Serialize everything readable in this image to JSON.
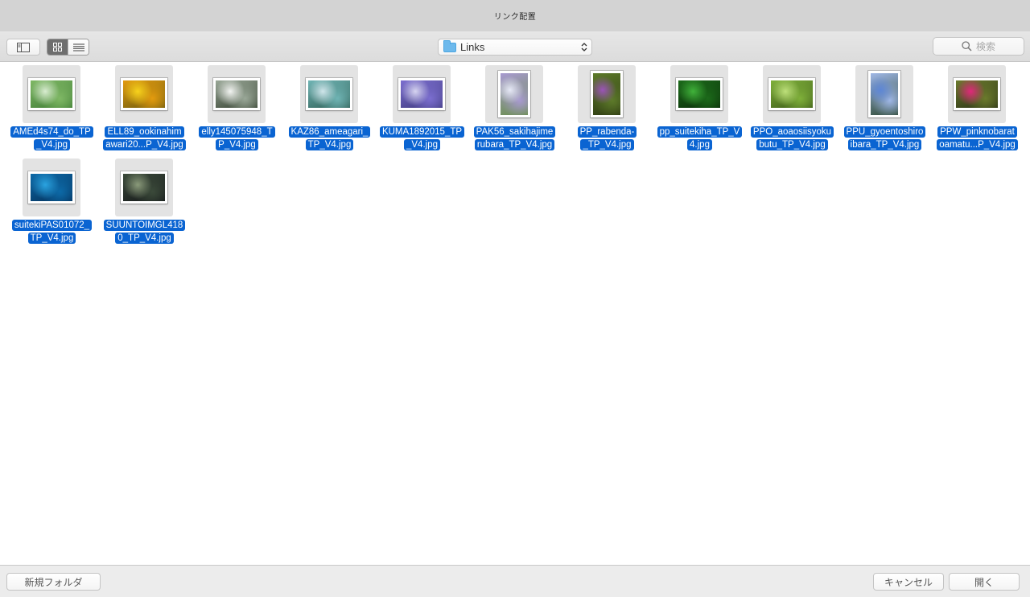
{
  "window": {
    "title": "リンク配置"
  },
  "toolbar": {
    "location": "Links",
    "search_placeholder": "検索"
  },
  "files": [
    {
      "name": "AMEd4s74_do_TP_V4.jpg",
      "caption": [
        "AMEd4s74_do_TP",
        "_V4.jpg"
      ],
      "orientation": "landscape",
      "colors": [
        "#d8ecd0",
        "#7fb865",
        "#3f7c35"
      ]
    },
    {
      "name": "ELL89_ookinahimawari20...P_V4.jpg",
      "caption": [
        "ELL89_ookinahim",
        "awari20...P_V4.jpg"
      ],
      "orientation": "landscape",
      "colors": [
        "#f7d21c",
        "#e39b0e",
        "#6a5a10"
      ]
    },
    {
      "name": "elly145075948_TP_V4.jpg",
      "caption": [
        "elly145075948_T",
        "P_V4.jpg"
      ],
      "orientation": "landscape",
      "colors": [
        "#f2f4f1",
        "#9aa898",
        "#34402f"
      ]
    },
    {
      "name": "KAZ86_ameagari_TP_V4.jpg",
      "caption": [
        "KAZ86_ameagari_",
        "TP_V4.jpg"
      ],
      "orientation": "landscape",
      "colors": [
        "#cfe5ea",
        "#6fb4b4",
        "#2f5f55"
      ]
    },
    {
      "name": "KUMA1892015_TP_V4.jpg",
      "caption": [
        "KUMA1892015_TP",
        "_V4.jpg"
      ],
      "orientation": "landscape",
      "colors": [
        "#d6d4f0",
        "#7b6ecf",
        "#3f3a7e"
      ]
    },
    {
      "name": "PAK56_sakihajimerubara_TP_V4.jpg",
      "caption": [
        "PAK56_sakihajime",
        "rubara_TP_V4.jpg"
      ],
      "orientation": "portrait",
      "colors": [
        "#e6e9f6",
        "#a89ad0",
        "#6a8f4c"
      ]
    },
    {
      "name": "PP_rabenda-_TP_V4.jpg",
      "caption": [
        "PP_rabenda-",
        "_TP_V4.jpg"
      ],
      "orientation": "portrait",
      "colors": [
        "#9b54b8",
        "#5d7a2a",
        "#2d3a12"
      ]
    },
    {
      "name": "pp_suitekiha_TP_V4.jpg",
      "caption": [
        "pp_suitekiha_TP_V",
        "4.jpg"
      ],
      "orientation": "landscape",
      "colors": [
        "#40b23a",
        "#1c6a1a",
        "#0a2c09"
      ]
    },
    {
      "name": "PPO_aoaosiisyokubutu_TP_V4.jpg",
      "caption": [
        "PPO_aoaosiisyoku",
        "butu_TP_V4.jpg"
      ],
      "orientation": "landscape",
      "colors": [
        "#bde07a",
        "#7fb03a",
        "#3c5a18"
      ]
    },
    {
      "name": "PPU_gyoentoshiroibara_TP_V4.jpg",
      "caption": [
        "PPU_gyoentoshiro",
        "ibara_TP_V4.jpg"
      ],
      "orientation": "portrait",
      "colors": [
        "#5d86d6",
        "#9fb7e6",
        "#2f4a34"
      ]
    },
    {
      "name": "PPW_pinknobaratoamatu...P_V4.jpg",
      "caption": [
        "PPW_pinknobarat",
        "oamatu...P_V4.jpg"
      ],
      "orientation": "landscape",
      "colors": [
        "#e0287a",
        "#6b7a2c",
        "#2b3318"
      ]
    },
    {
      "name": "suitekiPAS01072_TP_V4.jpg",
      "caption": [
        "suitekiPAS01072_",
        "TP_V4.jpg"
      ],
      "orientation": "landscape",
      "colors": [
        "#2aa3e0",
        "#0d6aa8",
        "#05305a"
      ]
    },
    {
      "name": "SUUNTOIMGL4180_TP_V4.jpg",
      "caption": [
        "SUUNTOIMGL418",
        "0_TP_V4.jpg"
      ],
      "orientation": "landscape",
      "colors": [
        "#8a9a7a",
        "#3b4a3a",
        "#15181a"
      ]
    }
  ],
  "footer": {
    "new_folder": "新規フォルダ",
    "cancel": "キャンセル",
    "open": "開く"
  }
}
